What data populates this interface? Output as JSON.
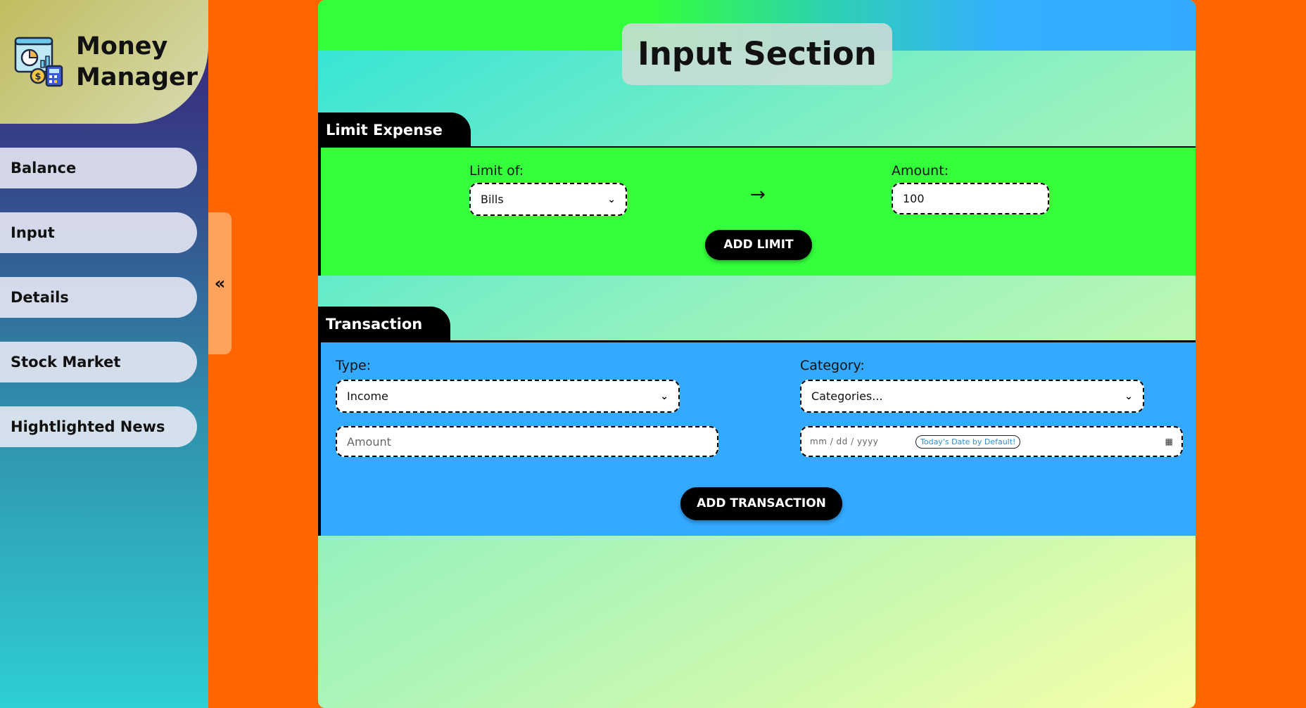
{
  "app": {
    "title": "Money Manager"
  },
  "sidebar": {
    "items": [
      {
        "label": "Balance"
      },
      {
        "label": "Input"
      },
      {
        "label": "Details"
      },
      {
        "label": "Stock Market"
      },
      {
        "label": "Hightlighted News"
      }
    ],
    "collapse_glyph": "«"
  },
  "main": {
    "title": "Input Section"
  },
  "limit_section": {
    "heading": "Limit Expense",
    "limit_label": "Limit of:",
    "limit_value": "Bills",
    "arrow_glyph": "→",
    "amount_label": "Amount:",
    "amount_value": "100",
    "button_label": "ADD LIMIT"
  },
  "transaction_section": {
    "heading": "Transaction",
    "type_label": "Type:",
    "type_value": "Income",
    "category_label": "Category:",
    "category_value": "Categories...",
    "amount_placeholder": "Amount",
    "date_placeholder": "mm / dd / yyyy",
    "date_hint": "Today's Date by Default!",
    "button_label": "ADD TRANSACTION"
  },
  "icons": {
    "logo": "finance-dashboard-icon",
    "chevron": "chevron-down-icon",
    "calendar": "calendar-icon"
  },
  "colors": {
    "background": "#ff6600",
    "limit_panel": "#33ff3b",
    "transaction_panel": "#33aaff",
    "handle": "#ffa35c"
  }
}
